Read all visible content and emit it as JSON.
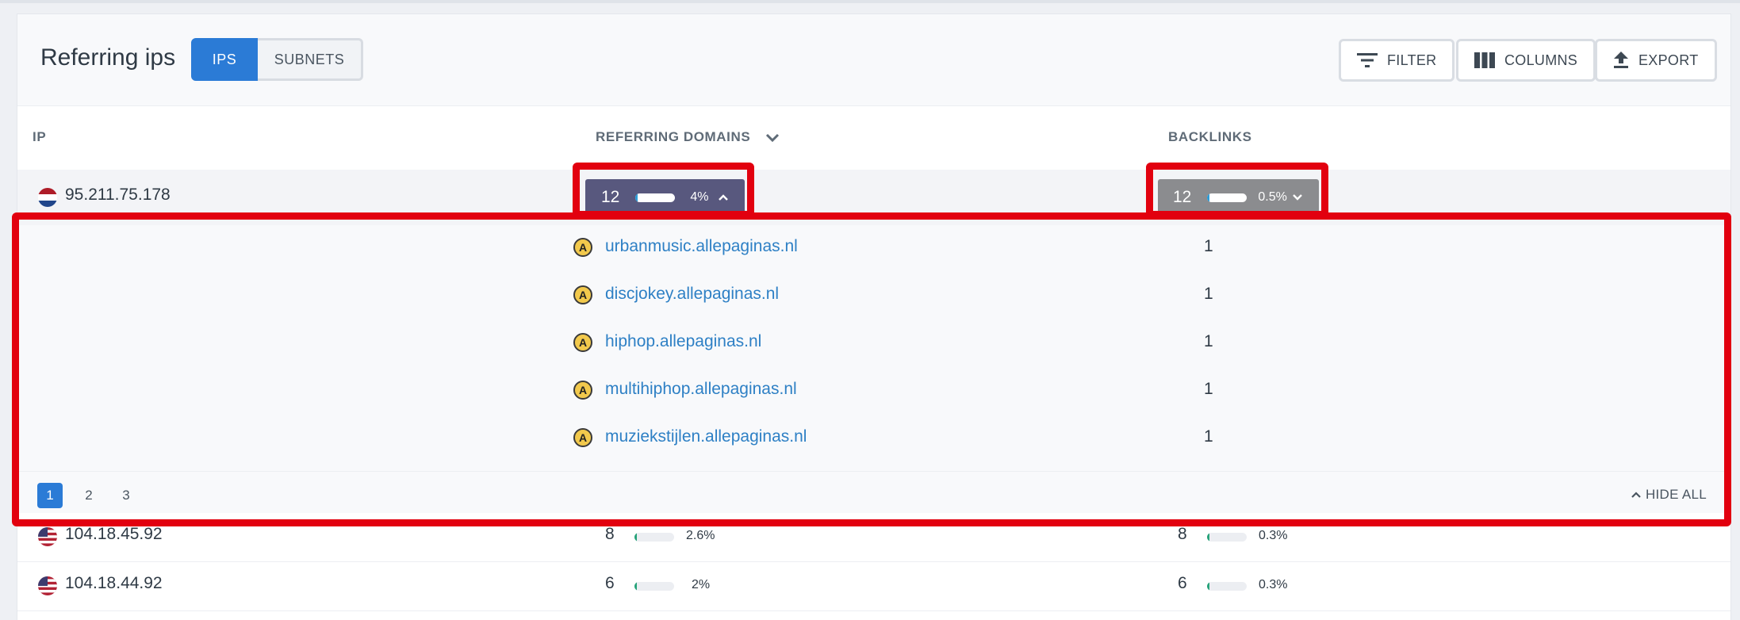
{
  "header": {
    "title": "Referring ips",
    "tabs": [
      {
        "label": "IPS",
        "active": true
      },
      {
        "label": "SUBNETS",
        "active": false
      }
    ],
    "actions": {
      "filter_label": "FILTER",
      "columns_label": "COLUMNS",
      "export_label": "EXPORT"
    }
  },
  "columns": {
    "ip": "IP",
    "referring_domains": "REFERRING DOMAINS",
    "backlinks": "BACKLINKS"
  },
  "expanded_row": {
    "ip": "95.211.75.178",
    "country": "Netherlands",
    "referring_domains": {
      "value": "12",
      "percent": "4%",
      "fraction": 0.04
    },
    "backlinks": {
      "value": "12",
      "percent": "0.5%",
      "fraction": 0.005
    },
    "domains": [
      {
        "name": "urbanmusic.allepaginas.nl",
        "count": "1"
      },
      {
        "name": "discjokey.allepaginas.nl",
        "count": "1"
      },
      {
        "name": "hiphop.allepaginas.nl",
        "count": "1"
      },
      {
        "name": "multihiphop.allepaginas.nl",
        "count": "1"
      },
      {
        "name": "muziekstijlen.allepaginas.nl",
        "count": "1"
      }
    ],
    "pagination": {
      "pages": [
        "1",
        "2",
        "3"
      ],
      "current": "1"
    },
    "hide_all_label": "HIDE ALL"
  },
  "rows": [
    {
      "ip": "104.18.45.92",
      "country": "United States",
      "referring_domains": {
        "value": "8",
        "percent": "2.6%",
        "fraction": 0.026
      },
      "backlinks": {
        "value": "8",
        "percent": "0.3%",
        "fraction": 0.003
      }
    },
    {
      "ip": "104.18.44.92",
      "country": "United States",
      "referring_domains": {
        "value": "6",
        "percent": "2%",
        "fraction": 0.02
      },
      "backlinks": {
        "value": "6",
        "percent": "0.3%",
        "fraction": 0.003
      }
    }
  ],
  "colors": {
    "accent": "#2b7bd6",
    "pill_active": "#58587e",
    "pill_backlinks": "#8b8c8f",
    "highlight": "#e2000f",
    "link": "#2e80c5"
  }
}
